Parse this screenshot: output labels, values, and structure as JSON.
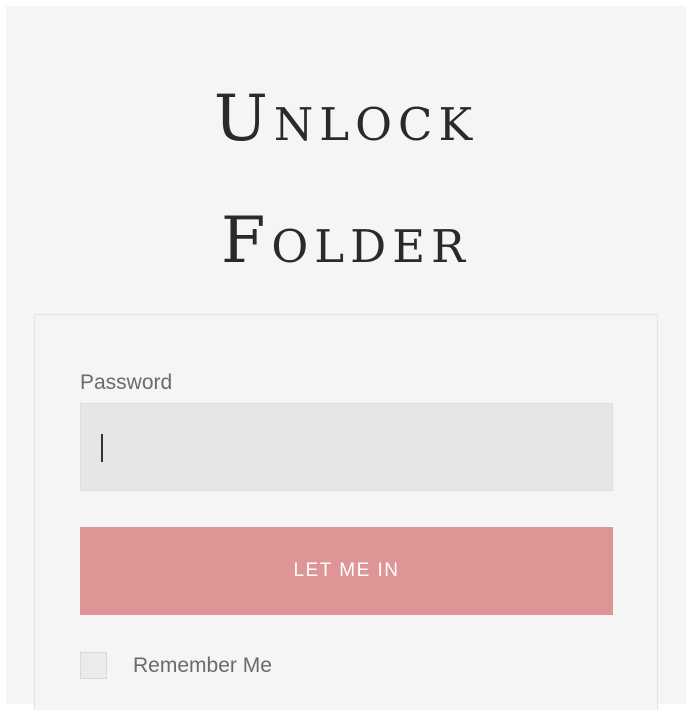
{
  "title": {
    "line1": "Unlock",
    "line2": "Folder"
  },
  "form": {
    "password_label": "Password",
    "password_value": "",
    "submit_label": "LET ME IN",
    "remember_label": "Remember Me",
    "remember_checked": false
  },
  "colors": {
    "background": "#f5f5f5",
    "button": "#df9595",
    "input": "#e6e6e6"
  }
}
